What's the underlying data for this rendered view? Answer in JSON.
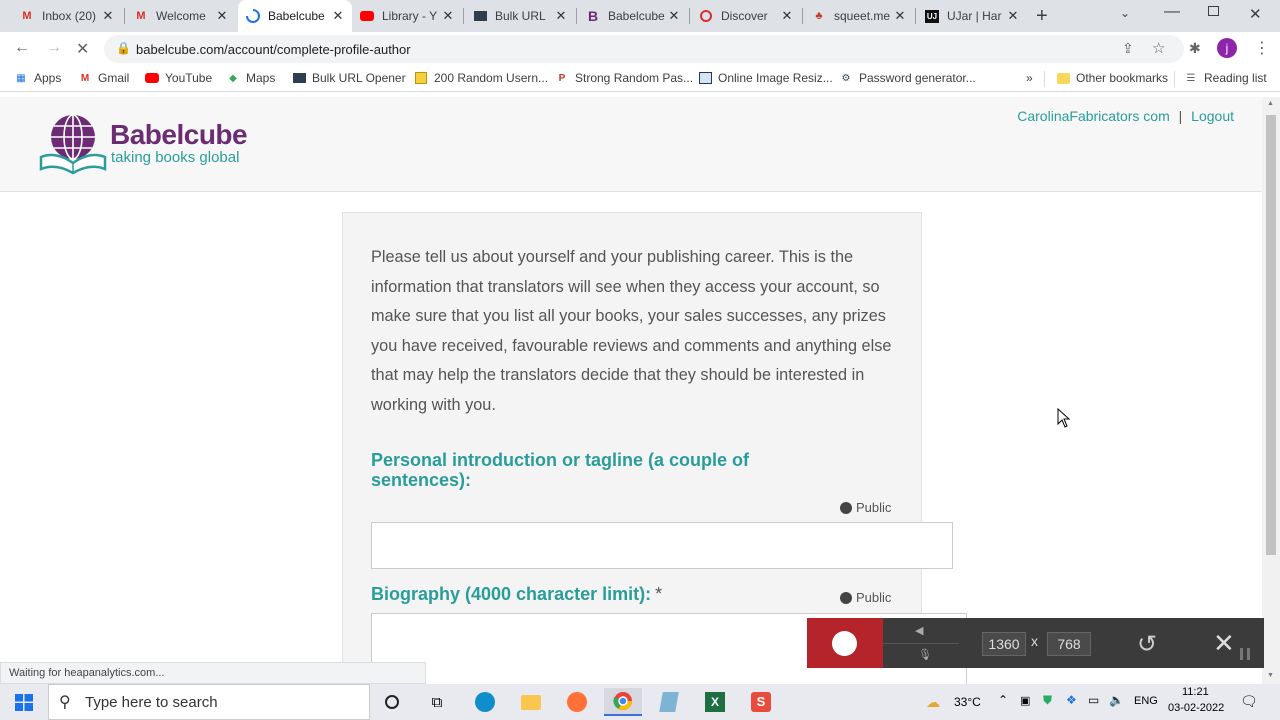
{
  "browser": {
    "tabs": [
      {
        "title": "Inbox (20)",
        "icon": "gmail-icon",
        "active": false
      },
      {
        "title": "Welcome",
        "icon": "gmail-icon",
        "active": false
      },
      {
        "title": "Babelcube",
        "icon": "loading-icon",
        "active": true
      },
      {
        "title": "Library - Y",
        "icon": "youtube-icon",
        "active": false
      },
      {
        "title": "Bulk URL",
        "icon": "bulk-url-icon",
        "active": false
      },
      {
        "title": "Babelcube",
        "icon": "babelcube-icon",
        "active": false
      },
      {
        "title": "Discover",
        "icon": "discover-icon",
        "active": false
      },
      {
        "title": "squeet.me",
        "icon": "squid-icon",
        "active": false
      },
      {
        "title": "UJar | Har",
        "icon": "ujar-icon",
        "active": false
      }
    ],
    "url": "babelcube.com/account/complete-profile-author",
    "profile_initial": "j",
    "bookmarks": [
      {
        "label": "Apps",
        "icon": "apps-grid-icon"
      },
      {
        "label": "Gmail",
        "icon": "gmail-icon"
      },
      {
        "label": "YouTube",
        "icon": "youtube-icon"
      },
      {
        "label": "Maps",
        "icon": "maps-icon"
      },
      {
        "label": "Bulk URL Opener",
        "icon": "bulk-url-icon"
      },
      {
        "label": "200 Random Usern...",
        "icon": "note-icon"
      },
      {
        "label": "Strong Random Pas...",
        "icon": "key-icon"
      },
      {
        "label": "Online Image Resiz...",
        "icon": "image-icon"
      },
      {
        "label": "Password generator...",
        "icon": "gear-icon"
      }
    ],
    "more_bookmarks": "»",
    "other_bookmarks": "Other bookmarks",
    "reading_list": "Reading list",
    "status_text": "Waiting for heapanalytics.com..."
  },
  "site": {
    "logo_name": "Babelcube",
    "logo_tagline": "taking books global",
    "account_link": "CarolinaFabricators com",
    "separator": "|",
    "logout_link": "Logout"
  },
  "form": {
    "intro": "Please tell us about yourself and your publishing career. This is the information that translators will see when they access your account, so make sure that you list all your books, your sales successes, any prizes you have received, favourable reviews and comments and anything else that may help the translators decide that they should be interested in working with you.",
    "tagline_label": "Personal introduction or tagline (a couple of sentences):",
    "tagline_visibility": "Public",
    "tagline_value": "",
    "bio_label": "Biography (4000 character limit):",
    "bio_required": "*",
    "bio_visibility": "Public",
    "bio_value": ""
  },
  "recorder": {
    "width": "1360",
    "times": "x",
    "height": "768"
  },
  "taskbar": {
    "search_placeholder": "Type here to search",
    "weather": "33°C",
    "language": "ENG",
    "time": "11:21",
    "date": "03-02-2022"
  },
  "colors": {
    "brand_purple": "#6b2c73",
    "brand_teal": "#2a9d9b",
    "record_red": "#b4242a"
  }
}
